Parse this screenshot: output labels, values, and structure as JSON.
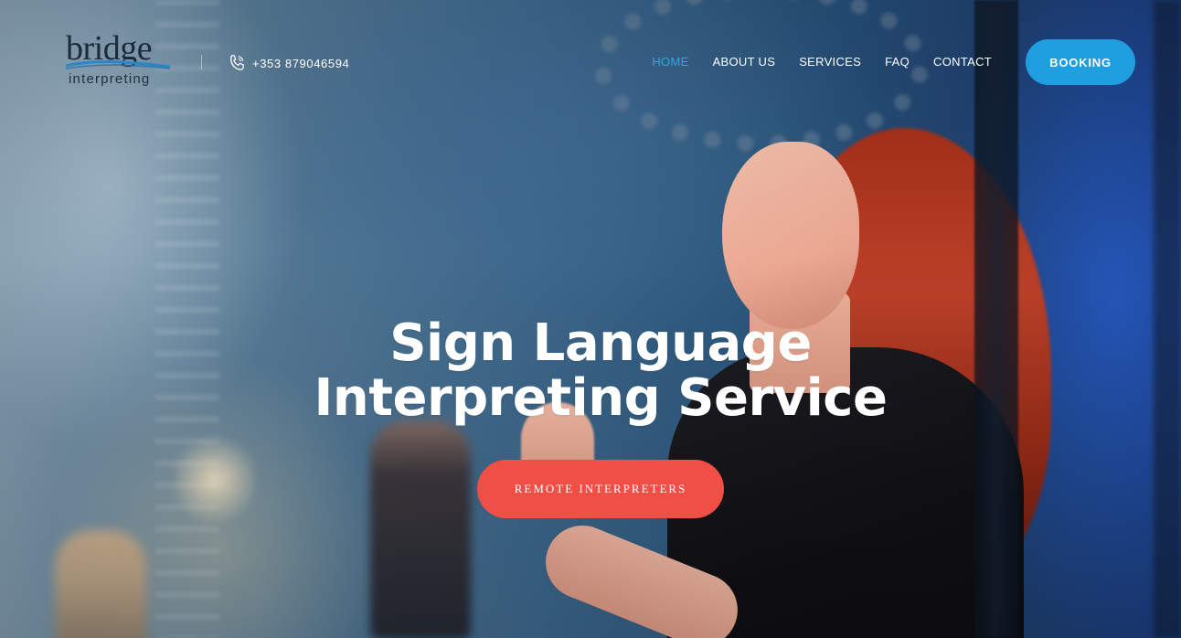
{
  "header": {
    "logo": {
      "word": "bridge",
      "sub": "interpreting"
    },
    "phone": {
      "icon": "phone-icon",
      "number": "+353 879046594"
    },
    "nav": [
      {
        "label": "HOME",
        "active": true
      },
      {
        "label": "ABOUT US",
        "active": false
      },
      {
        "label": "SERVICES",
        "active": false
      },
      {
        "label": "FAQ",
        "active": false
      },
      {
        "label": "CONTACT",
        "active": false
      }
    ],
    "booking_label": "BOOKING"
  },
  "hero": {
    "title_line1": "Sign Language",
    "title_line2": "Interpreting Service",
    "cta_label": "REMOTE INTERPRETERS"
  },
  "colors": {
    "accent_blue": "#1f9fe0",
    "nav_active": "#29a9e1",
    "cta_red": "#ef4f45",
    "logo_dark": "#1a2b3d"
  }
}
